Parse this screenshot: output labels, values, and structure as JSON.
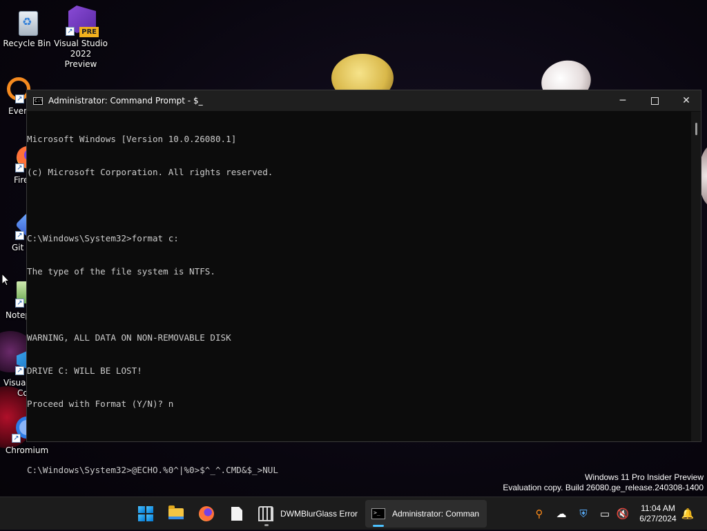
{
  "desktop": {
    "icons": [
      {
        "label_line1": "Recycle Bin",
        "label_line2": "",
        "icon": "recycle-bin-icon"
      },
      {
        "label_line1": "Visual Studio",
        "label_line2": "2022 Preview",
        "icon": "visual-studio-preview-icon",
        "badge": "PRE"
      },
      {
        "label_line1": "Every",
        "label_line2": "",
        "icon": "everything-search-icon"
      },
      {
        "label_line1": "Fire",
        "label_line2": "",
        "icon": "firefox-icon"
      },
      {
        "label_line1": "Git E",
        "label_line2": "",
        "icon": "git-extensions-icon"
      },
      {
        "label_line1": "Notep",
        "label_line2": "",
        "icon": "notepad-plus-plus-icon"
      },
      {
        "label_line1": "Visual",
        "label_line2": "Co",
        "icon": "vscode-icon"
      },
      {
        "label_line1": "Chromium",
        "label_line2": "",
        "icon": "chromium-icon"
      }
    ]
  },
  "window": {
    "title": "Administrator: Command Prompt - $_",
    "icon": "command-prompt-icon",
    "controls": {
      "minimize": "─",
      "maximize": "□",
      "close": "✕"
    },
    "console_lines": [
      "Microsoft Windows [Version 10.0.26080.1]",
      "(c) Microsoft Corporation. All rights reserved.",
      "",
      "C:\\Windows\\System32>format c:",
      "The type of the file system is NTFS.",
      "",
      "WARNING, ALL DATA ON NON-REMOVABLE DISK",
      "DRIVE C: WILL BE LOST!",
      "Proceed with Format (Y/N)? n",
      "",
      "C:\\Windows\\System32>@ECHO.%0^|%0>$^_^.CMD&$_>NUL"
    ]
  },
  "watermark": {
    "line1": "Windows 11 Pro Insider Preview",
    "line2": "Evaluation copy. Build 26080.ge_release.240308-1400"
  },
  "taskbar": {
    "items": [
      {
        "icon": "windows-start-icon"
      },
      {
        "icon": "file-explorer-icon"
      },
      {
        "icon": "firefox-icon"
      },
      {
        "icon": "file-icon"
      },
      {
        "icon": "dwmblurglass-icon",
        "label": "DWMBlurGlass Error"
      },
      {
        "icon": "command-prompt-icon",
        "label": "Administrator: Comman"
      }
    ],
    "tray": {
      "icons": [
        "everything-search-icon",
        "onedrive-offline-icon",
        "windows-security-icon",
        "network-icon",
        "volume-muted-icon",
        "notification-bell-icon"
      ],
      "time": "11:04 AM",
      "date": "6/27/2024"
    }
  }
}
